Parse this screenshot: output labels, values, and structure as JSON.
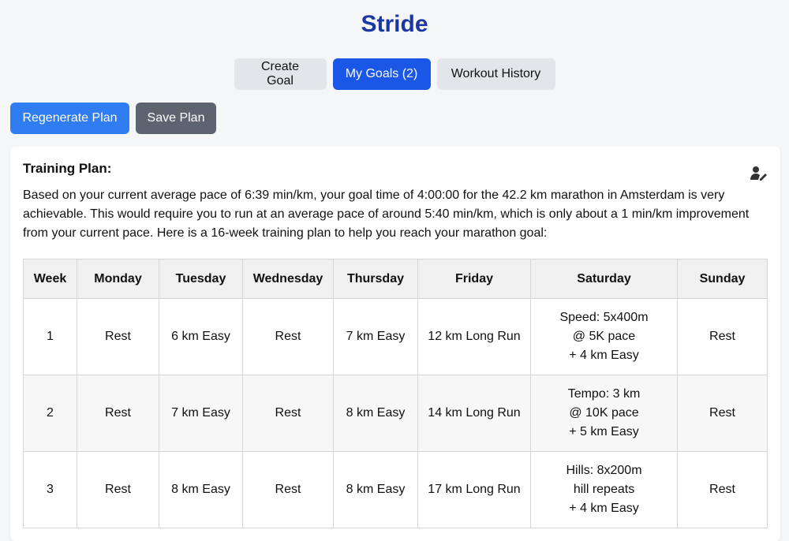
{
  "app": {
    "title": "Stride"
  },
  "tabs": [
    {
      "label": "Create Goal",
      "active": false
    },
    {
      "label": "My Goals (2)",
      "active": true
    },
    {
      "label": "Workout History",
      "active": false
    }
  ],
  "actions": {
    "regenerate_label": "Regenerate Plan",
    "save_label": "Save Plan"
  },
  "plan": {
    "heading": "Training Plan:",
    "edit_icon": "user-edit-icon",
    "description": "Based on your current average pace of 6:39 min/km, your goal time of 4:00:00 for the 42.2 km marathon in Amsterdam is very achievable. This would require you to run at an average pace of around 5:40 min/km, which is only about a 1 min/km improvement from your current pace. Here is a 16-week training plan to help you reach your marathon goal:",
    "columns": [
      "Week",
      "Monday",
      "Tuesday",
      "Wednesday",
      "Thursday",
      "Friday",
      "Saturday",
      "Sunday"
    ],
    "rows": [
      {
        "week": "1",
        "monday": "Rest",
        "tuesday": "6 km Easy",
        "wednesday": "Rest",
        "thursday": "7 km Easy",
        "friday": "12 km Long Run",
        "saturday": [
          "Speed: 5x400m",
          "@ 5K pace",
          "+ 4 km Easy"
        ],
        "sunday": "Rest"
      },
      {
        "week": "2",
        "monday": "Rest",
        "tuesday": "7 km Easy",
        "wednesday": "Rest",
        "thursday": "8 km Easy",
        "friday": "14 km Long Run",
        "saturday": [
          "Tempo: 3 km",
          "@ 10K pace",
          "+ 5 km Easy"
        ],
        "sunday": "Rest"
      },
      {
        "week": "3",
        "monday": "Rest",
        "tuesday": "8 km Easy",
        "wednesday": "Rest",
        "thursday": "8 km Easy",
        "friday": "17 km Long Run",
        "saturday": [
          "Hills: 8x200m",
          "hill repeats",
          "+ 4 km Easy"
        ],
        "sunday": "Rest"
      }
    ]
  }
}
